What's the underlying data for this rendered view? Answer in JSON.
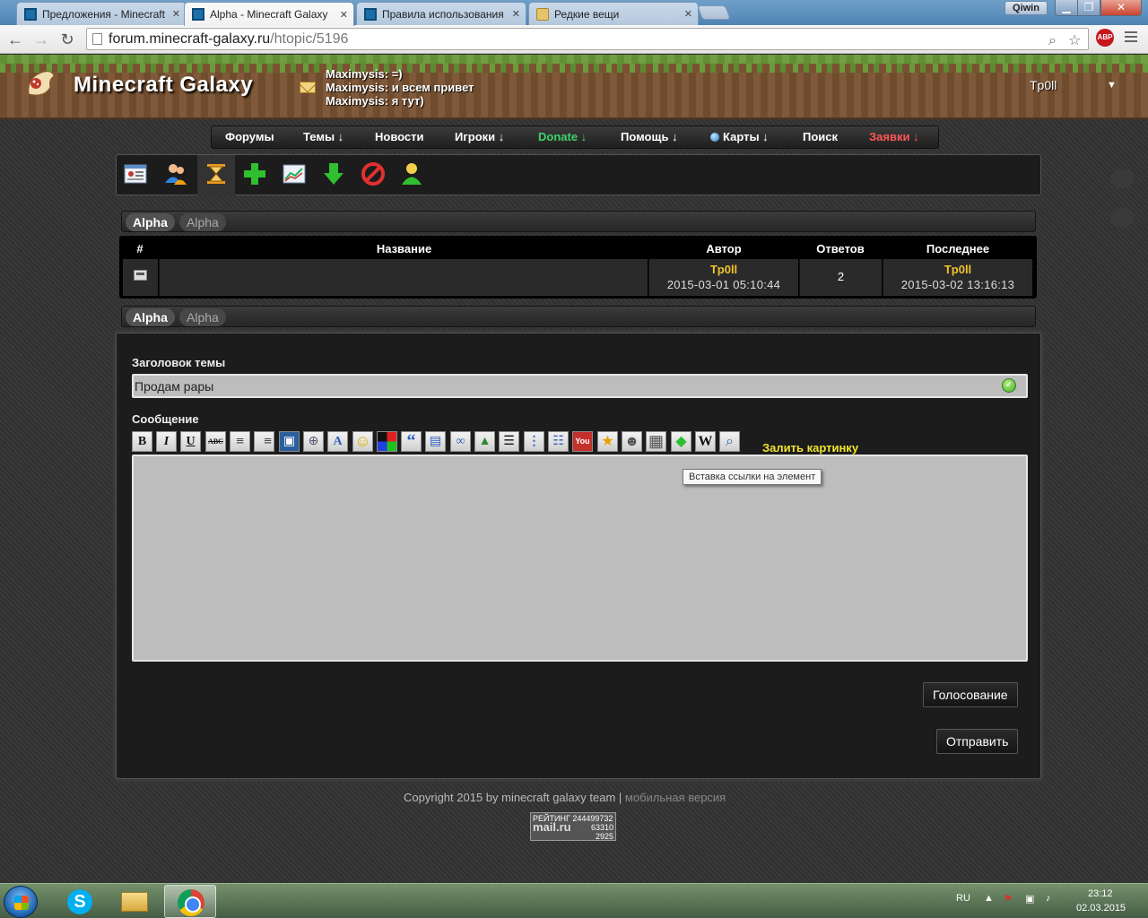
{
  "browser": {
    "tabs": [
      {
        "label": "Предложения - Minecraft",
        "active": false
      },
      {
        "label": "Alpha - Minecraft Galaxy",
        "active": true
      },
      {
        "label": "Правила использования",
        "active": false
      },
      {
        "label": "Редкие вещи",
        "active": false
      }
    ],
    "window_user": "Qiwin",
    "url_host": "forum.minecraft-galaxy.ru",
    "url_path": "/htopic/5196",
    "abp_label": "ABP"
  },
  "header": {
    "site_title": "Minecraft Galaxy",
    "chat": [
      "Maximysis: =)",
      "Maximysis: и всем привет",
      "Maximysis: я тут)"
    ],
    "username": "Tp0ll",
    "caret": "▼"
  },
  "mainnav": {
    "forums": "Форумы",
    "topics": "Темы ↓",
    "news": "Новости",
    "players": "Игроки ↓",
    "donate": "Donate ↓",
    "help": "Помощь ↓",
    "maps": "Карты ↓",
    "search": "Поиск",
    "requests": "Заявки ↓"
  },
  "breadcrumb": {
    "first": "Alpha",
    "second": "Alpha"
  },
  "topic_table": {
    "headers": {
      "num": "#",
      "title": "Название",
      "author": "Автор",
      "replies": "Ответов",
      "last": "Последнее"
    },
    "row": {
      "title": "",
      "author": "Tp0ll",
      "author_date": "2015-03-01 05:10:44",
      "replies": "2",
      "last_user": "Tp0ll",
      "last_date": "2015-03-02 13:16:13"
    }
  },
  "form": {
    "title_label": "Заголовок темы",
    "title_value": "Продам рары",
    "message_label": "Сообщение",
    "upload_link": "Залить картинку",
    "tooltip": "Вставка ссылки на элемент",
    "poll_button": "Голосование",
    "submit_button": "Отправить",
    "editor_buttons": [
      "B",
      "I",
      "U",
      "ABC",
      "≡",
      "≡",
      "▣",
      "⊕",
      "A",
      "☺",
      "■",
      "“",
      "▤",
      "∞",
      "▲",
      "☰",
      "⋮",
      "☷",
      "You",
      "★",
      "☻",
      "▦",
      "◆",
      "W",
      "⌕"
    ]
  },
  "footer": {
    "copyright": "Copyright 2015 by minecraft galaxy team",
    "separator": " | ",
    "mobile": "мобильная версия",
    "counter_top": "РЕЙТИНГ 244499732",
    "counter_brand": "mail.ru",
    "counter_n1": "63310",
    "counter_n2": "2925"
  },
  "taskbar": {
    "lang": "RU",
    "time": "23:12",
    "date": "02.03.2015"
  }
}
